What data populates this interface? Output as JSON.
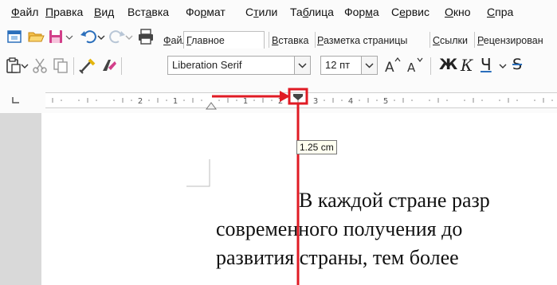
{
  "menu": {
    "items": [
      {
        "pre": "",
        "u": "Ф",
        "post": "айл"
      },
      {
        "pre": "",
        "u": "П",
        "post": "равка"
      },
      {
        "pre": "",
        "u": "В",
        "post": "ид"
      },
      {
        "pre": "Вст",
        "u": "а",
        "post": "вка"
      },
      {
        "pre": "Фо",
        "u": "р",
        "post": "мат"
      },
      {
        "pre": "С",
        "u": "т",
        "post": "или"
      },
      {
        "pre": "Та",
        "u": "б",
        "post": "лица"
      },
      {
        "pre": "Фор",
        "u": "м",
        "post": "а"
      },
      {
        "pre": "С",
        "u": "е",
        "post": "рвис"
      },
      {
        "pre": "",
        "u": "О",
        "post": "кно"
      },
      {
        "pre": "",
        "u": "С",
        "post": "пра"
      }
    ]
  },
  "tabs": [
    {
      "pre": "",
      "u": "Ф",
      "post": "айл"
    },
    {
      "pre": "",
      "u": "Г",
      "post": "лавное"
    },
    {
      "pre": "",
      "u": "В",
      "post": "ставка"
    },
    {
      "pre": "",
      "u": "Р",
      "post": "азметка страницы"
    },
    {
      "pre": "",
      "u": "С",
      "post": "сылки"
    },
    {
      "pre": "",
      "u": "Р",
      "post": "ецензирован"
    }
  ],
  "font": {
    "name": "Liberation Serif",
    "size": "12 пт"
  },
  "format": {
    "bold": "Ж",
    "italic": "К",
    "underline": "Ч",
    "strike": "S"
  },
  "ruler": {
    "labels": [
      "2",
      "1",
      "1",
      "2",
      "3",
      "4",
      "5"
    ],
    "tooltip": "1.25 cm"
  },
  "document": {
    "lines": [
      "В каждой стране разр",
      "современного получения до",
      "развития страны, тем более"
    ]
  },
  "colors": {
    "annotation": "#e01b24",
    "accent": "#2a6ebb"
  }
}
